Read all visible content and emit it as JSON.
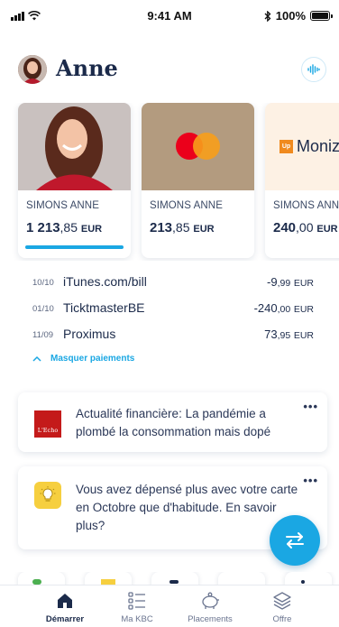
{
  "status_bar": {
    "time": "9:41 AM",
    "battery": "100%"
  },
  "header": {
    "user_name": "Anne"
  },
  "cards": [
    {
      "holder": "SIMONS ANNE",
      "amount_int": "1 213",
      "amount_dec": ",85",
      "currency": "EUR",
      "active": true
    },
    {
      "holder": "SIMONS ANNE",
      "amount_int": "213",
      "amount_dec": ",85",
      "currency": "EUR",
      "active": false
    },
    {
      "holder": "SIMONS ANNE",
      "amount_int": "240",
      "amount_dec": ",00",
      "currency": "EUR",
      "brand": "Moniz",
      "brand_badge": "Up",
      "active": false
    }
  ],
  "transactions": [
    {
      "date": "10/10",
      "payee": "iTunes.com/bill",
      "amount": "-9",
      "decimals": ",99",
      "currency": "EUR"
    },
    {
      "date": "01/10",
      "payee": "TicktmasterBE",
      "amount": "-240",
      "decimals": ",00",
      "currency": "EUR"
    },
    {
      "date": "11/09",
      "payee": "Proximus",
      "amount": "73",
      "decimals": ",95",
      "currency": "EUR"
    }
  ],
  "hide_payments_label": "Masquer paiements",
  "notifications": [
    {
      "text": "Actualité financière: La pandémie a plombé la consommation mais dopé",
      "logo": "L'Echo",
      "more": "•••"
    },
    {
      "text": "Vous avez dépensé plus avec votre carte en Octobre que d'habitude. En savoir plus?",
      "more": "•••"
    }
  ],
  "tabs": [
    {
      "label": "Démarrer",
      "active": true
    },
    {
      "label": "Ma KBC",
      "active": false
    },
    {
      "label": "Placements",
      "active": false
    },
    {
      "label": "Offre",
      "active": false
    }
  ],
  "colors": {
    "accent": "#1aa7e3",
    "navy": "#1b2a4a",
    "mastercard_bg": "#b39b7f",
    "mastercard_red": "#eb001b",
    "mastercard_orange": "#f79e1b",
    "echo_red": "#c41a1a",
    "bulb_yellow": "#f6cf3f"
  },
  "icons": {
    "voice": "voice-wave-icon",
    "transfer": "transfer-arrows-icon",
    "home": "home-icon",
    "list": "list-icon",
    "piggy": "piggy-bank-icon",
    "stack": "stack-layers-icon",
    "chevron": "chevron-up-icon",
    "bulb": "lightbulb-icon"
  }
}
